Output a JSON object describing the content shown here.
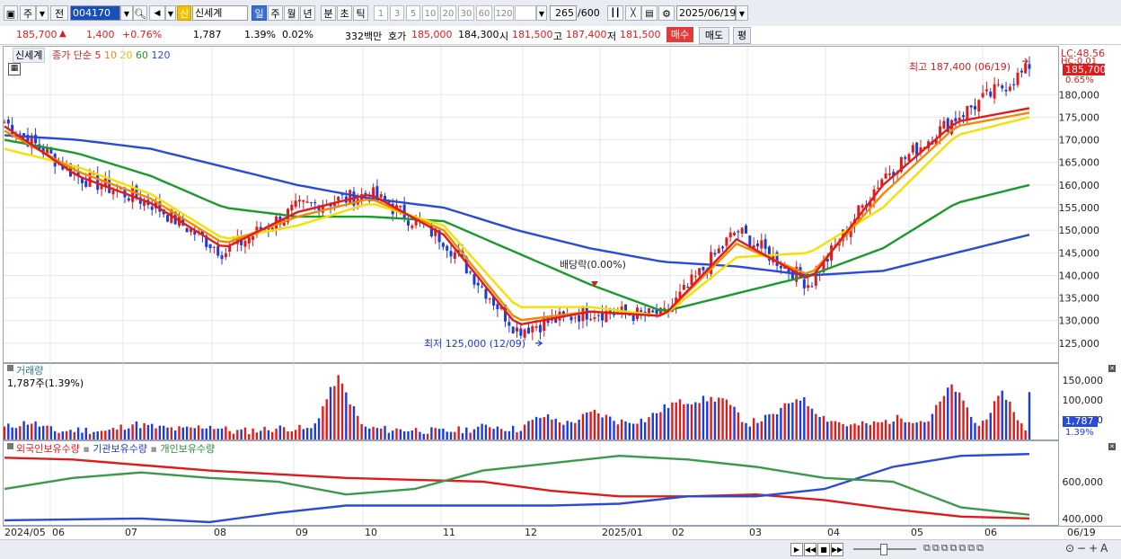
{
  "toolbar": {
    "market_btn": "주",
    "prev_btn": "전",
    "code_value": "004170",
    "stock_badge": "신",
    "stock_name": "신세계",
    "periods": [
      "일",
      "주",
      "월",
      "년",
      "분",
      "초",
      "틱"
    ],
    "active_period": "일",
    "minute_opts": [
      "1",
      "3",
      "5",
      "10",
      "20",
      "30",
      "60",
      "120"
    ],
    "count_value": "265",
    "count_total": "/600",
    "date_value": "2025/06/19"
  },
  "quote": {
    "price": "185,700",
    "change": "1,400",
    "change_pct": "+0.76%",
    "volume": "1,787",
    "turnover_pct": "1.39%",
    "ratio": "0.02%",
    "amount": "332백만",
    "ask_label": "호가",
    "ask": "185,000",
    "bid": "184,300",
    "open_label": "시",
    "open": "181,500",
    "high_label": "고",
    "high": "187,400",
    "low_label": "저",
    "low": "181,500",
    "buy_btn": "매수",
    "sell_btn": "매도",
    "eval_btn": "평"
  },
  "price_panel": {
    "name_tab": "신세계",
    "legend_label": "종가 단순",
    "ma_periods": [
      "5",
      "10",
      "20",
      "60",
      "120"
    ],
    "ma_colors": [
      "#e31a1a",
      "#f28a00",
      "#f2e200",
      "#1a9a2a",
      "#2a4ad8"
    ],
    "lc_label": "LC:48.56",
    "hc_label": "HC:0.01",
    "current_price_tag": "185,700",
    "current_pct": "0.65%",
    "high_annotation": "최고 187,400 (06/19)",
    "low_annotation": "최저 125,000 (12/09)",
    "dividend_annotation": "배당락(0.00%)"
  },
  "volume_panel": {
    "title": "거래량",
    "subtitle": "1,787주(1.39%)",
    "tag_value": "1,787",
    "tag_pct": "1.39%"
  },
  "holding_panel": {
    "legend": [
      "외국인보유수량",
      "기관보유수량",
      "개인보유수량"
    ],
    "colors": [
      "#e01b1b",
      "#2a4ad8",
      "#3a9a4a"
    ]
  },
  "x_axis": {
    "labels": [
      "2024/05",
      "06",
      "07",
      "08",
      "09",
      "10",
      "11",
      "12",
      "2025/01",
      "02",
      "03",
      "04",
      "05",
      "06",
      "06/19"
    ]
  },
  "chart_data": [
    {
      "type": "candlestick",
      "title": "신세계",
      "y_ticks": [
        125000,
        130000,
        135000,
        140000,
        145000,
        150000,
        155000,
        160000,
        165000,
        170000,
        175000,
        180000
      ],
      "ylim": [
        121000,
        190000
      ],
      "series": [
        {
          "name": "종가",
          "x": [
            "2024/05",
            "06",
            "07",
            "08",
            "09",
            "10",
            "11",
            "12",
            "2025/01",
            "02",
            "03",
            "04",
            "05",
            "06",
            "06/19"
          ],
          "values": [
            174000,
            162000,
            156000,
            145000,
            155000,
            158000,
            148000,
            128000,
            132000,
            131000,
            150000,
            138000,
            162000,
            175000,
            185700
          ]
        },
        {
          "name": "5",
          "values": [
            173000,
            162000,
            156000,
            146000,
            154000,
            158000,
            149000,
            129000,
            132000,
            131000,
            148000,
            139000,
            160000,
            174000,
            177000
          ]
        },
        {
          "name": "10",
          "values": [
            172000,
            163000,
            157000,
            147000,
            153000,
            157000,
            150000,
            130000,
            132000,
            131000,
            147000,
            140000,
            158000,
            173000,
            176000
          ]
        },
        {
          "name": "20",
          "values": [
            168000,
            164000,
            158000,
            148000,
            151000,
            156000,
            151000,
            133000,
            133000,
            131000,
            144000,
            145000,
            155000,
            171000,
            175000
          ]
        },
        {
          "name": "60",
          "values": [
            170000,
            167000,
            162000,
            155000,
            153000,
            153000,
            152000,
            145000,
            138000,
            132000,
            136000,
            140000,
            146000,
            156000,
            160000
          ]
        },
        {
          "name": "120",
          "values": [
            171000,
            170000,
            168000,
            164000,
            160000,
            157000,
            155000,
            150000,
            146000,
            143000,
            142000,
            140000,
            141000,
            145000,
            149000
          ]
        }
      ],
      "annotations": {
        "high": 187400,
        "high_date": "06/19",
        "low": 125000,
        "low_date": "12/09"
      }
    },
    {
      "type": "bar",
      "title": "거래량",
      "y_ticks": [
        50000,
        100000,
        150000
      ],
      "ylim": [
        0,
        180000
      ],
      "values": [
        30000,
        45000,
        20000,
        25000,
        20000,
        40000,
        30000,
        25000,
        35000,
        20000,
        25000,
        30000,
        25000,
        160000,
        30000,
        25000,
        25000,
        20000,
        25000,
        35000,
        25000,
        60000,
        40000,
        70000,
        45000,
        50000,
        90000,
        100000,
        105000,
        40000,
        60000,
        110000,
        55000,
        35000,
        40000,
        55000,
        45000,
        140000,
        30000,
        120000,
        1787
      ]
    },
    {
      "type": "line",
      "title": "보유수량",
      "y_ticks": [
        400000,
        600000
      ],
      "ylim": [
        370000,
        790000
      ],
      "series": [
        {
          "name": "외국인보유수량",
          "values": [
            730000,
            720000,
            690000,
            660000,
            640000,
            620000,
            610000,
            600000,
            550000,
            520000,
            520000,
            530000,
            500000,
            450000,
            410000,
            400000
          ]
        },
        {
          "name": "기관보유수량",
          "values": [
            390000,
            395000,
            400000,
            380000,
            430000,
            470000,
            470000,
            470000,
            470000,
            480000,
            520000,
            520000,
            560000,
            680000,
            740000,
            750000
          ]
        },
        {
          "name": "개인보유수량",
          "values": [
            560000,
            620000,
            650000,
            620000,
            600000,
            530000,
            560000,
            660000,
            700000,
            740000,
            720000,
            680000,
            620000,
            600000,
            460000,
            420000
          ]
        }
      ]
    }
  ]
}
